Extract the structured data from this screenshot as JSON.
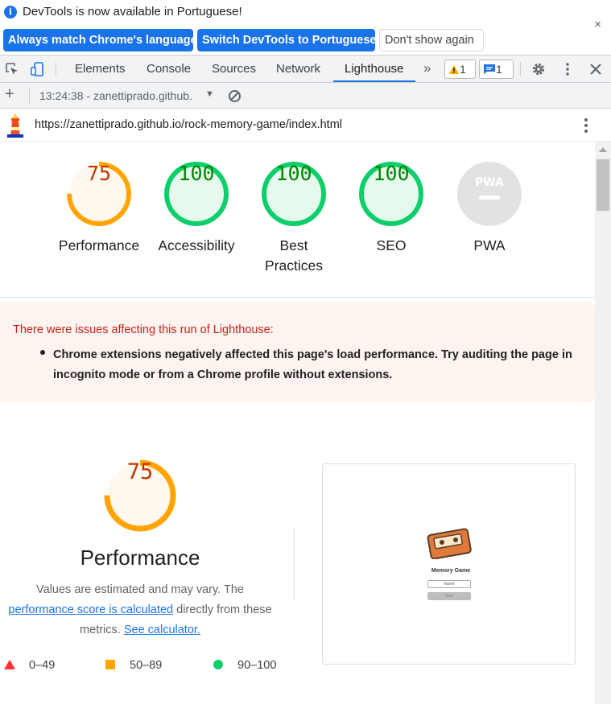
{
  "infobar": {
    "message": "DevTools is now available in Portuguese!",
    "buttons": {
      "match_language": "Always match Chrome's language",
      "switch_language": "Switch DevTools to Portuguese",
      "dont_show": "Don't show again"
    },
    "close_glyph": "×"
  },
  "tabs": {
    "items": [
      "Elements",
      "Console",
      "Sources",
      "Network",
      "Lighthouse"
    ],
    "active": "Lighthouse",
    "more_glyph": "»",
    "warnings_count": "1",
    "messages_count": "1"
  },
  "lighthouse_bar": {
    "new_report_glyph": "+",
    "report_selector": "13:24:38 - zanettiprado.github.",
    "caret": "▼"
  },
  "url_bar": {
    "url": "https://zanettiprado.github.io/rock-memory-game/index.html"
  },
  "scores": [
    {
      "label": "Performance",
      "value": "75",
      "level": "average"
    },
    {
      "label": "Accessibility",
      "value": "100",
      "level": "pass"
    },
    {
      "label": "Best\nPractices",
      "value": "100",
      "level": "pass"
    },
    {
      "label": "SEO",
      "value": "100",
      "level": "pass"
    },
    {
      "label": "PWA",
      "value": "PWA",
      "level": "na"
    }
  ],
  "gauge_colors": {
    "pass": "#0cce6b",
    "pass_fill": "#e6f9ed",
    "pass_text": "#008800",
    "average": "#ffa400",
    "average_fill": "#fff8ef",
    "average_text": "#c33300",
    "na": "#e2e2e2",
    "na_text": "#ffffff"
  },
  "warning": {
    "title": "There were issues affecting this run of Lighthouse:",
    "item": "Chrome extensions negatively affected this page's load performance. Try auditing the page in incognito mode or from a Chrome profile without extensions."
  },
  "performance": {
    "score": "75",
    "score_fraction": 0.75,
    "title": "Performance",
    "desc_before": "Values are estimated and may vary. The",
    "link_text": "performance score is calculated",
    "desc_middle": " directly from these metrics. ",
    "calculator_link": "See calculator."
  },
  "legend": [
    {
      "range": "0–49",
      "shape": "triangle",
      "color": "#ff3333"
    },
    {
      "range": "50–89",
      "shape": "square",
      "color": "#ffa400"
    },
    {
      "range": "90–100",
      "shape": "circle",
      "color": "#0cce6b"
    }
  ],
  "screenshot": {
    "title": "Memory Game",
    "input_placeholder": "Name",
    "button_label": "Start"
  }
}
